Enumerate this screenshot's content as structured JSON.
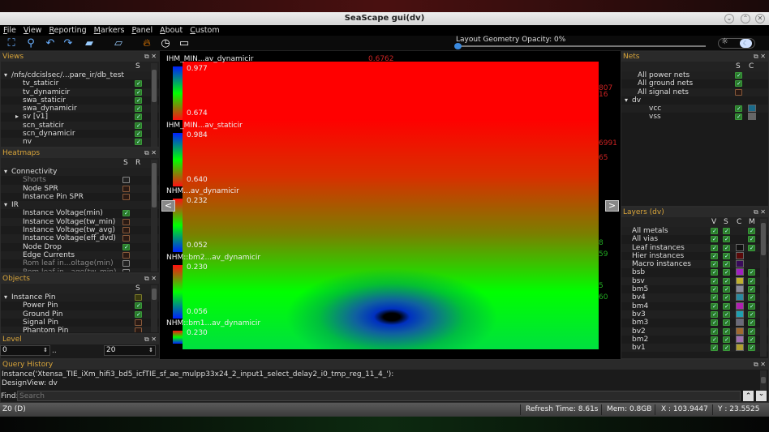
{
  "window": {
    "title": "SeaScape gui(dv)",
    "min": "⌄",
    "max": "⌃",
    "close": "✕"
  },
  "menu": [
    "File",
    "View",
    "Reporting",
    "Markers",
    "Panel",
    "About",
    "Custom"
  ],
  "toolbar": {
    "opacity_label": "Layout Geometry Opacity: 0%",
    "opacity_value": 0
  },
  "views": {
    "title": "Views",
    "col": "S",
    "items": [
      {
        "label": "/nfs/cdcislsec/...pare_ir/db_test",
        "indent": 0,
        "arrow": "▾",
        "check": null
      },
      {
        "label": "tv_staticir",
        "indent": 2,
        "check": "on"
      },
      {
        "label": "tv_dynamicir",
        "indent": 2,
        "check": "on"
      },
      {
        "label": "swa_staticir",
        "indent": 2,
        "check": "on"
      },
      {
        "label": "swa_dynamicir",
        "indent": 2,
        "check": "on"
      },
      {
        "label": "sv [v1]",
        "indent": 2,
        "arrow": "▸",
        "check": "on"
      },
      {
        "label": "scn_staticir",
        "indent": 2,
        "check": "on"
      },
      {
        "label": "scn_dynamicir",
        "indent": 2,
        "check": "on"
      },
      {
        "label": "nv",
        "indent": 2,
        "check": "on"
      }
    ]
  },
  "heatmaps": {
    "title": "Heatmaps",
    "cols": [
      "S",
      "R"
    ],
    "items": [
      {
        "label": "Connectivity",
        "indent": 0,
        "arrow": "▾",
        "check": null
      },
      {
        "label": "Shorts",
        "indent": 2,
        "check": "gray",
        "dim": true
      },
      {
        "label": "Node SPR",
        "indent": 2,
        "check": "off"
      },
      {
        "label": "Instance Pin SPR",
        "indent": 2,
        "check": "off"
      },
      {
        "label": "IR",
        "indent": 0,
        "arrow": "▾",
        "check": null
      },
      {
        "label": "Instance Voltage(min)",
        "indent": 2,
        "check": "on"
      },
      {
        "label": "Instance Voltage(tw_min)",
        "indent": 2,
        "check": "off"
      },
      {
        "label": "Instance Voltage(tw_avg)",
        "indent": 2,
        "check": "off"
      },
      {
        "label": "Instance Voltage(eff_dvd)",
        "indent": 2,
        "check": "off"
      },
      {
        "label": "Node Drop",
        "indent": 2,
        "check": "on"
      },
      {
        "label": "Edge Currents",
        "indent": 2,
        "check": "off"
      },
      {
        "label": "Rom leaf in...oltage(min)",
        "indent": 2,
        "check": "gray",
        "dim": true
      },
      {
        "label": "Rom leaf in...age(tw_min)",
        "indent": 2,
        "check": "gray",
        "dim": true
      }
    ]
  },
  "objects": {
    "title": "Objects",
    "col": "S",
    "items": [
      {
        "label": "Instance Pin",
        "indent": 0,
        "arrow": "▾",
        "check": "part"
      },
      {
        "label": "Power Pin",
        "indent": 2,
        "check": "on"
      },
      {
        "label": "Ground Pin",
        "indent": 2,
        "check": "on"
      },
      {
        "label": "Signal Pin",
        "indent": 2,
        "check": "off"
      },
      {
        "label": "Phantom Pin",
        "indent": 2,
        "check": "off"
      }
    ]
  },
  "level": {
    "title": "Level",
    "from": "0",
    "sep": "..",
    "to": "20"
  },
  "legends": [
    {
      "title": "IHM_MIN...av_dynamicir",
      "max": "0.977",
      "min": "0.674",
      "scale": "bgr"
    },
    {
      "title": "IHM_MIN...av_staticir",
      "max": "0.984",
      "min": "0.640",
      "scale": "bgr"
    },
    {
      "title": "NHM...av_dynamicir",
      "max": "0.232",
      "min": "0.052",
      "scale": "rgb"
    },
    {
      "title": "NHM::bm2...av_dynamicir",
      "max": "0.230",
      "min": "0.056",
      "scale": "rgb"
    },
    {
      "title": "NHM::bm1...av_dynamicir",
      "max": "0.230",
      "min": "",
      "scale": "rgb"
    }
  ],
  "canvas_labels": {
    "top": "0.6762",
    "right": [
      "807",
      "16",
      "6991",
      "65",
      "8",
      "59",
      "5",
      "60"
    ]
  },
  "nav": {
    "prev": "<",
    "next": ">"
  },
  "nets": {
    "title": "Nets",
    "cols": [
      "S",
      "C"
    ],
    "items": [
      {
        "label": "All power nets",
        "indent": 1,
        "s": "on"
      },
      {
        "label": "All ground nets",
        "indent": 1,
        "s": "on"
      },
      {
        "label": "All signal nets",
        "indent": 1,
        "s": "off"
      },
      {
        "label": "dv",
        "indent": 0,
        "arrow": "▾"
      },
      {
        "label": "vcc",
        "indent": 3,
        "s": "on",
        "color": "#1a6a8a"
      },
      {
        "label": "vss",
        "indent": 3,
        "s": "on",
        "color": "#666666"
      }
    ]
  },
  "layers": {
    "title": "Layers (dv)",
    "cols": [
      "V",
      "S",
      "C",
      "M"
    ],
    "items": [
      {
        "label": "All metals",
        "m": true
      },
      {
        "label": "All vias",
        "m": true
      },
      {
        "label": "Leaf instances",
        "color": "#111111",
        "m": true
      },
      {
        "label": "Hier instances",
        "color": "#5a0a0a",
        "m": false
      },
      {
        "label": "Macro instances",
        "color": "#3a0a5a",
        "m": false
      },
      {
        "label": "bsb",
        "color": "#a020c0",
        "m": true
      },
      {
        "label": "bsv",
        "color": "#c0b030",
        "m": true
      },
      {
        "label": "bm5",
        "color": "#8a8a9a",
        "m": true
      },
      {
        "label": "bv4",
        "color": "#2a8aa0",
        "m": true
      },
      {
        "label": "bm4",
        "color": "#b020b0",
        "m": true
      },
      {
        "label": "bv3",
        "color": "#20a0b0",
        "m": true
      },
      {
        "label": "bm3",
        "color": "#6a6a7a",
        "m": true
      },
      {
        "label": "bv2",
        "color": "#a06a30",
        "m": true
      },
      {
        "label": "bm2",
        "color": "#a070b0",
        "m": true
      },
      {
        "label": "bv1",
        "color": "#b0a030",
        "m": true
      }
    ]
  },
  "query": {
    "title": "Query History",
    "lines": [
      "Instance('Xtensa_TIE_iXm_hifi3_bd5_icfTIE_sf_ae_mulpp33x24_2_input1_select_delay2_i0_tmp_reg_11_4_'):",
      "DesignView: dv"
    ],
    "find_label": "Find:",
    "find_placeholder": "Search",
    "up": "⌃",
    "down": "⌄"
  },
  "status": {
    "left": "Z0 (D)",
    "refresh": "Refresh Time: 8.61s",
    "mem": "Mem: 0.8GB",
    "x": "X : 103.9447",
    "y": "Y : 23.5525"
  }
}
